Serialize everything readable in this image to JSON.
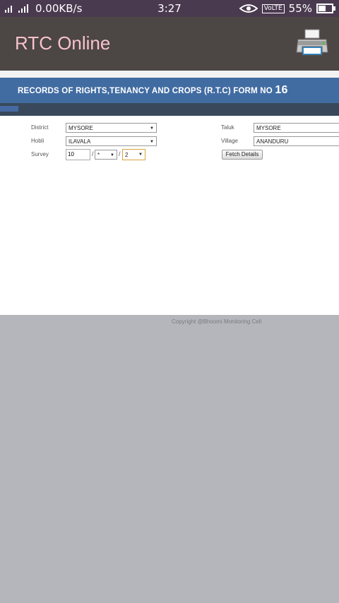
{
  "status_bar": {
    "network_speed": "0.00KB/s",
    "time": "3:27",
    "volte": "VoLTE",
    "battery": "55%"
  },
  "app": {
    "title": "RTC Online",
    "print_icon": "printer-icon"
  },
  "banner": {
    "text": "RECORDS OF RIGHTS,TENANCY AND CROPS (R.T.C) FORM NO",
    "form_no": "16"
  },
  "form": {
    "district_label": "District",
    "district_value": "MYSORE",
    "taluk_label": "Taluk",
    "taluk_value": "MYSORE",
    "hobli_label": "Hobli",
    "hobli_value": "ILAVALA",
    "village_label": "Village",
    "village_value": "ANANDURU",
    "survey_label": "Survey",
    "survey_no": "10",
    "survey_sep1": "/",
    "surnoc_value": "*",
    "survey_sep2": "/",
    "hissa_value": "2",
    "fetch_button": "Fetch Details"
  },
  "footer": {
    "copyright": "Copyright @Bhoomi Monitoring Cell"
  },
  "colors": {
    "status_bar": "#4a3a4f",
    "app_bar": "#4c4644",
    "app_title": "#f6c3cc",
    "banner": "#416ca2",
    "background": "#b4b6bc"
  }
}
